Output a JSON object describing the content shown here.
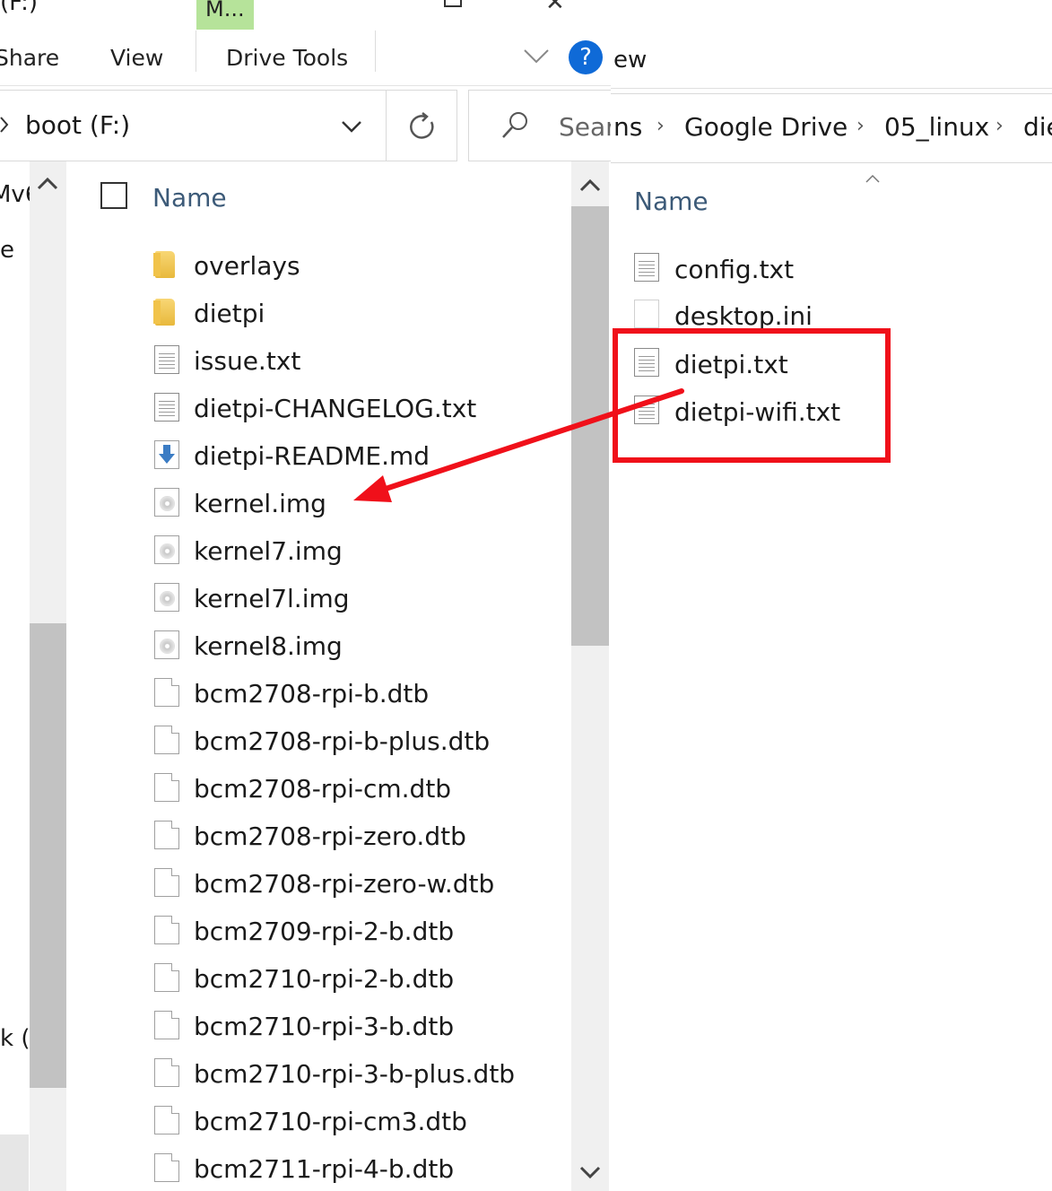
{
  "left_window": {
    "title_fragment": "(F:)",
    "context_tab_label": "M...",
    "ribbon_tabs": [
      "Share",
      "View",
      "Drive Tools"
    ],
    "help_label": "?",
    "address": "boot (F:)",
    "search_placeholder": "Sear",
    "nav_fragments": [
      "Mv6",
      "e",
      "k ("
    ],
    "column_header": "Name",
    "files": [
      {
        "name": "overlays",
        "icon": "folder-icon"
      },
      {
        "name": "dietpi",
        "icon": "folder-icon"
      },
      {
        "name": "issue.txt",
        "icon": "text-file-icon"
      },
      {
        "name": "dietpi-CHANGELOG.txt",
        "icon": "text-file-icon"
      },
      {
        "name": "dietpi-README.md",
        "icon": "markdown-file-icon"
      },
      {
        "name": "kernel.img",
        "icon": "disc-image-icon"
      },
      {
        "name": "kernel7.img",
        "icon": "disc-image-icon"
      },
      {
        "name": "kernel7l.img",
        "icon": "disc-image-icon"
      },
      {
        "name": "kernel8.img",
        "icon": "disc-image-icon"
      },
      {
        "name": "bcm2708-rpi-b.dtb",
        "icon": "blank-file-icon"
      },
      {
        "name": "bcm2708-rpi-b-plus.dtb",
        "icon": "blank-file-icon"
      },
      {
        "name": "bcm2708-rpi-cm.dtb",
        "icon": "blank-file-icon"
      },
      {
        "name": "bcm2708-rpi-zero.dtb",
        "icon": "blank-file-icon"
      },
      {
        "name": "bcm2708-rpi-zero-w.dtb",
        "icon": "blank-file-icon"
      },
      {
        "name": "bcm2709-rpi-2-b.dtb",
        "icon": "blank-file-icon"
      },
      {
        "name": "bcm2710-rpi-2-b.dtb",
        "icon": "blank-file-icon"
      },
      {
        "name": "bcm2710-rpi-3-b.dtb",
        "icon": "blank-file-icon"
      },
      {
        "name": "bcm2710-rpi-3-b-plus.dtb",
        "icon": "blank-file-icon"
      },
      {
        "name": "bcm2710-rpi-cm3.dtb",
        "icon": "blank-file-icon"
      },
      {
        "name": "bcm2711-rpi-4-b.dtb",
        "icon": "blank-file-icon"
      }
    ]
  },
  "right_window": {
    "ribbon_fragment": "ew",
    "breadcrumb": [
      "ns",
      "Google Drive",
      "05_linux",
      "die"
    ],
    "column_header": "Name",
    "files": [
      {
        "name": "config.txt",
        "icon": "text-file-icon"
      },
      {
        "name": "desktop.ini",
        "icon": "settings-file-icon"
      },
      {
        "name": "dietpi.txt",
        "icon": "text-file-icon"
      },
      {
        "name": "dietpi-wifi.txt",
        "icon": "text-file-icon"
      }
    ]
  },
  "annotation": {
    "color": "#f0101a",
    "highlighted_files": [
      "dietpi.txt",
      "dietpi-wifi.txt"
    ],
    "arrow_target": "kernel.img row area"
  }
}
